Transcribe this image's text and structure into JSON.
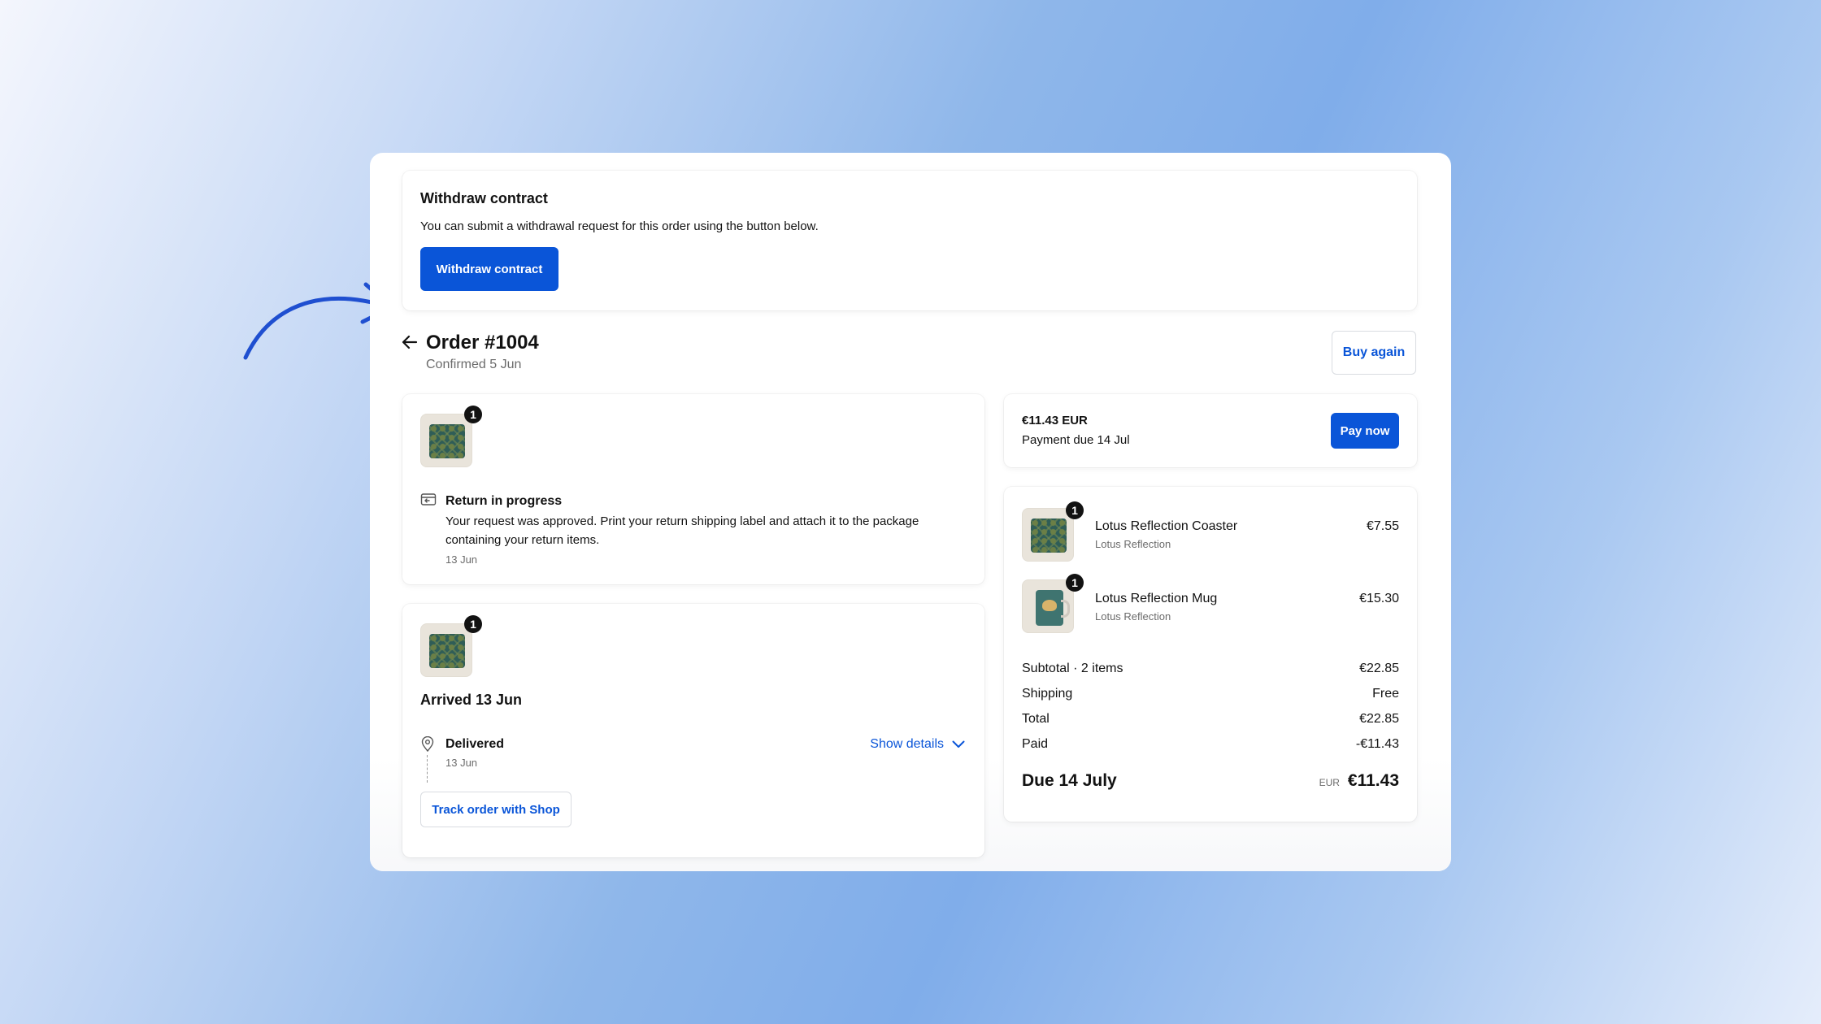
{
  "withdraw": {
    "title": "Withdraw contract",
    "description": "You can submit a withdrawal request for this order using the button below.",
    "button_label": "Withdraw contract"
  },
  "order": {
    "title": "Order #1004",
    "confirmed": "Confirmed 5 Jun",
    "buy_again_label": "Buy again"
  },
  "return_card": {
    "quantity": "1",
    "status_title": "Return in progress",
    "status_text": "Your request was approved. Print your return shipping label and attach it to the package containing your return items.",
    "date": "13 Jun"
  },
  "delivery_card": {
    "quantity": "1",
    "arrived": "Arrived 13 Jun",
    "status_title": "Delivered",
    "date": "13 Jun",
    "show_details_label": "Show details",
    "track_label": "Track order with Shop"
  },
  "payment": {
    "amount": "€11.43 EUR",
    "due_text": "Payment due 14 Jul",
    "pay_now_label": "Pay now"
  },
  "items": [
    {
      "name": "Lotus Reflection Coaster",
      "vendor": "Lotus Reflection",
      "price": "€7.55",
      "quantity": "1",
      "icon": "coaster-thumbnail"
    },
    {
      "name": "Lotus Reflection Mug",
      "vendor": "Lotus Reflection",
      "price": "€15.30",
      "quantity": "1",
      "icon": "mug-thumbnail"
    }
  ],
  "summary": {
    "subtotal_label": "Subtotal · 2 items",
    "subtotal_value": "€22.85",
    "shipping_label": "Shipping",
    "shipping_value": "Free",
    "total_label": "Total",
    "total_value": "€22.85",
    "paid_label": "Paid",
    "paid_value": "-€11.43",
    "due_label": "Due 14 July",
    "due_currency": "EUR",
    "due_value": "€11.43"
  },
  "colors": {
    "accent": "#0a55d8",
    "annotation_arrow": "#1f4fd0"
  }
}
